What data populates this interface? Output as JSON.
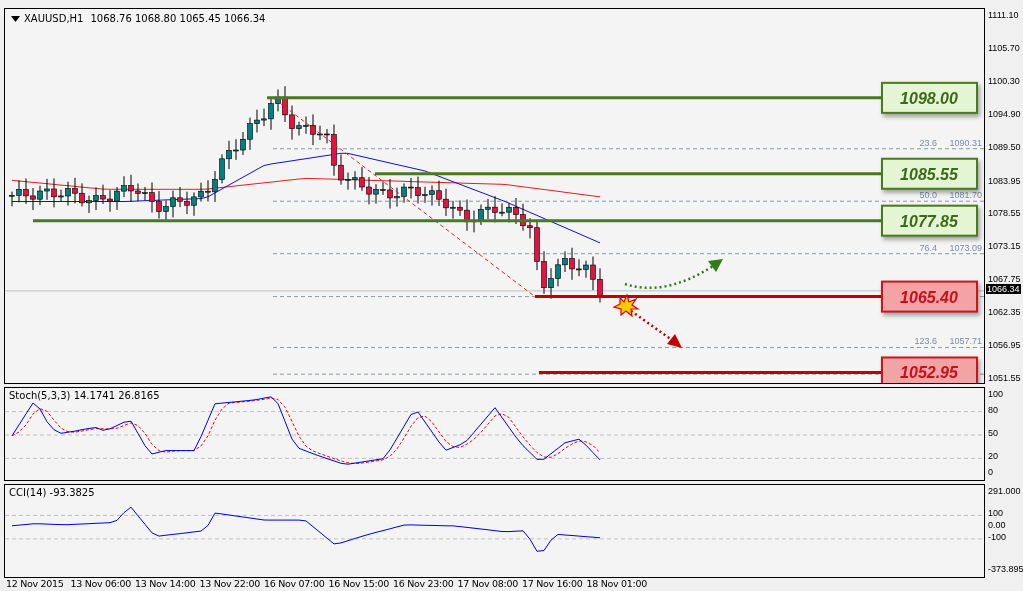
{
  "header": {
    "symbol": "XAUUSD,H1",
    "ohlc": "1068.76 1068.80 1065.45 1066.34"
  },
  "price_axis": {
    "ticks": [
      "1111.10",
      "1105.70",
      "1100.30",
      "1094.90",
      "1089.50",
      "1083.95",
      "1078.55",
      "1073.15",
      "1067.75",
      "1062.35",
      "1056.95",
      "1051.55"
    ],
    "current_price": "1066.34"
  },
  "levels": [
    {
      "price": "1098.00",
      "kind": "resistance"
    },
    {
      "price": "1085.55",
      "kind": "resistance"
    },
    {
      "price": "1077.85",
      "kind": "resistance"
    },
    {
      "price": "1065.40",
      "kind": "support"
    },
    {
      "price": "1052.95",
      "kind": "support"
    }
  ],
  "fibonacci": [
    {
      "ratio": "23.6",
      "price": "1090.31"
    },
    {
      "ratio": "50.0",
      "price": "1081.70"
    },
    {
      "ratio": "76.4",
      "price": "1073.09"
    },
    {
      "ratio": "123.6",
      "price": "1057.71"
    }
  ],
  "stochastic": {
    "label": "Stoch(5,3,3) 14.1741 26.8165",
    "ticks": [
      "100",
      "80",
      "50",
      "20",
      "0"
    ]
  },
  "cci": {
    "label": "CCI(14) -93.3825",
    "ticks": [
      "291.000",
      "100",
      "0.00",
      "-100",
      "-373.895"
    ]
  },
  "time_axis": [
    "12 Nov 2015",
    "13 Nov 06:00",
    "13 Nov 14:00",
    "13 Nov 22:00",
    "16 Nov 07:00",
    "16 Nov 15:00",
    "16 Nov 23:00",
    "17 Nov 08:00",
    "17 Nov 16:00",
    "18 Nov 01:00"
  ]
}
